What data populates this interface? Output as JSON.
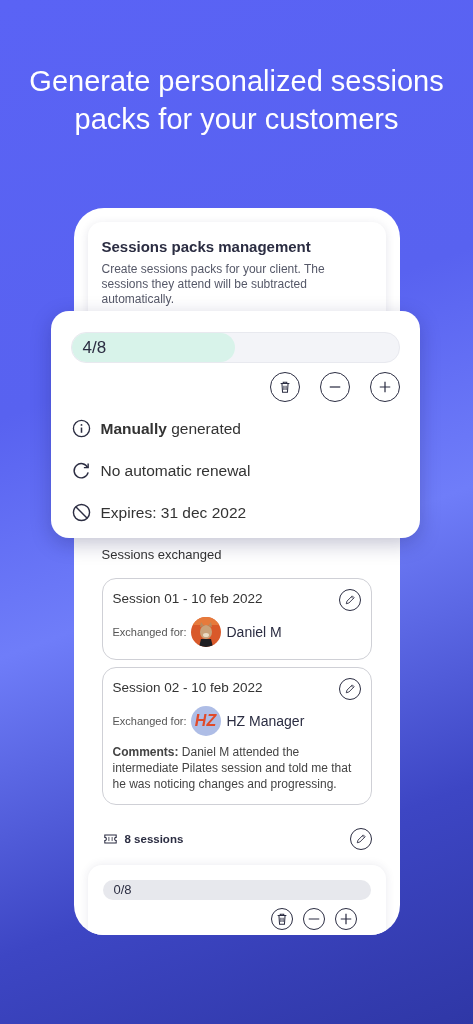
{
  "headline": "Generate personalized sessions packs for your customers",
  "panel": {
    "title": "Sessions packs management",
    "description": "Create sessions packs for your client. The sessions they attend will be subtracted automatically."
  },
  "pack": {
    "progress": {
      "label": "4/8",
      "level": 0.5
    },
    "actions": [
      {
        "kind": "delete"
      },
      {
        "kind": "minus"
      },
      {
        "kind": "plus"
      }
    ],
    "details": [
      {
        "kind": "info",
        "text": "**Manually** generated"
      },
      {
        "kind": "renewal",
        "text": "No automatic renewal"
      },
      {
        "kind": "expiry",
        "text": "Expires: 31 dec 2022"
      }
    ]
  },
  "exchanged": {
    "title": "Sessions exchanged",
    "sessions": [
      {
        "title": "Session 01 - 10 feb 2022",
        "label": "Exchanged for:",
        "person": {
          "name": "Daniel M"
        }
      },
      {
        "title": "Session 02 - 10 feb 2022",
        "label": "Exchanged for:",
        "person": {
          "name": "HZ Manager",
          "kind": "initials",
          "initials": "HZ"
        },
        "comment": "**Comments:** Daniel M attended the intermediate Pilates session and told me that he was noticing changes and progressing."
      }
    ]
  },
  "next_pack": {
    "title": "8 sessions",
    "progress": {
      "label": "0/8",
      "level": 0
    },
    "actions": [
      {
        "kind": "delete"
      },
      {
        "kind": "minus"
      },
      {
        "kind": "plus"
      }
    ]
  }
}
